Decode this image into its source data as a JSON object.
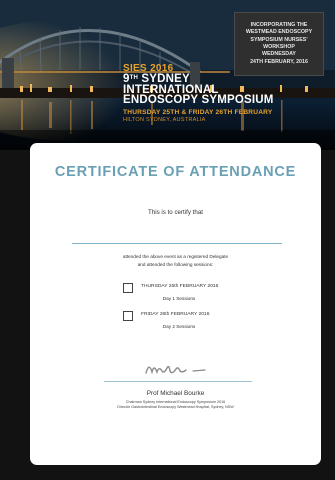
{
  "banner": {
    "workshop_lines": [
      "INCORPORATING THE",
      "WESTMEAD ENDOSCOPY",
      "SYMPOSIUM NURSES'",
      "WORKSHOP",
      "WEDNESDAY",
      "24TH FEBRUARY, 2016"
    ],
    "event_year": "SIES 2016",
    "event_number": "9",
    "event_number_suffix": "TH",
    "event_name_line1": "SYDNEY",
    "event_name_line2": "INTERNATIONAL",
    "event_name_line3": "ENDOSCOPY SYMPOSIUM",
    "dates": "THURSDAY 25TH & FRIDAY 26TH FEBRUARY",
    "venue": "HILTON SYDNEY, AUSTRALIA"
  },
  "certificate": {
    "title": "CERTIFICATE OF ATTENDANCE",
    "certify_text": "This is to certify that",
    "attended_line1": "attended the above event as a registered Delegate",
    "attended_line2": "and attended the following sessions:",
    "sessions": [
      {
        "day": "THURSDAY  25th FEBRUARY 2016",
        "label": "Day 1 Sessions"
      },
      {
        "day": "FRIDAY  26th FEBRUARY 2016",
        "label": "Day 2 Sessions"
      }
    ],
    "signer_name": "Prof Michael Bourke",
    "signer_role_line1": "Chairman Sydney International Endoscopy Symposium 2016",
    "signer_role_line2": "Director Gastrointestinal Endoscopy Westmead Hospital, Sydney, NSW"
  },
  "colors": {
    "accent_orange": "#e9a22c",
    "title_blue": "#6aa0b4",
    "background": "#121212"
  }
}
